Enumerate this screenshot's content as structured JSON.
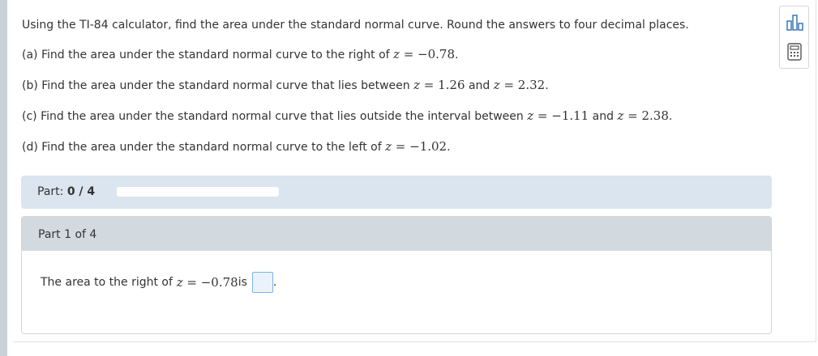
{
  "question": {
    "intro": "Using the TI-84 calculator, find the area under the standard normal curve. Round the answers to four decimal places.",
    "a": {
      "text": "(a) Find the area under the standard normal curve to the right of ",
      "var": "z",
      "math": " = −0.78",
      "end": "."
    },
    "b": {
      "text": "(b) Find the area under the standard normal curve that lies between ",
      "var1": "z",
      "math1": " = 1.26",
      "mid": " and ",
      "var2": "z",
      "math2": " = 2.32",
      "end": "."
    },
    "c": {
      "text": "(c) Find the area under the standard normal curve that lies outside the interval between ",
      "var1": "z",
      "math1": " = −1.11",
      "mid": " and ",
      "var2": "z",
      "math2": " = 2.38",
      "end": "."
    },
    "d": {
      "text": "(d) Find the area under the standard normal curve to the left of ",
      "var": "z",
      "math": " = −1.02",
      "end": "."
    }
  },
  "toolbox": {
    "icons": [
      "bar-chart-icon",
      "calculator-icon"
    ]
  },
  "progress": {
    "label": "Part: ",
    "value": "0 / 4",
    "fraction": 0
  },
  "part": {
    "header": "Part 1 of 4",
    "answer_prefix": "The area to the right of ",
    "var": "z",
    "math": " = −0.78",
    "answer_suffix": " is",
    "end": "."
  },
  "colors": {
    "accent": "#4a7fb5",
    "progress_bg": "#dae5ef",
    "header_bg": "#d3dadf"
  }
}
